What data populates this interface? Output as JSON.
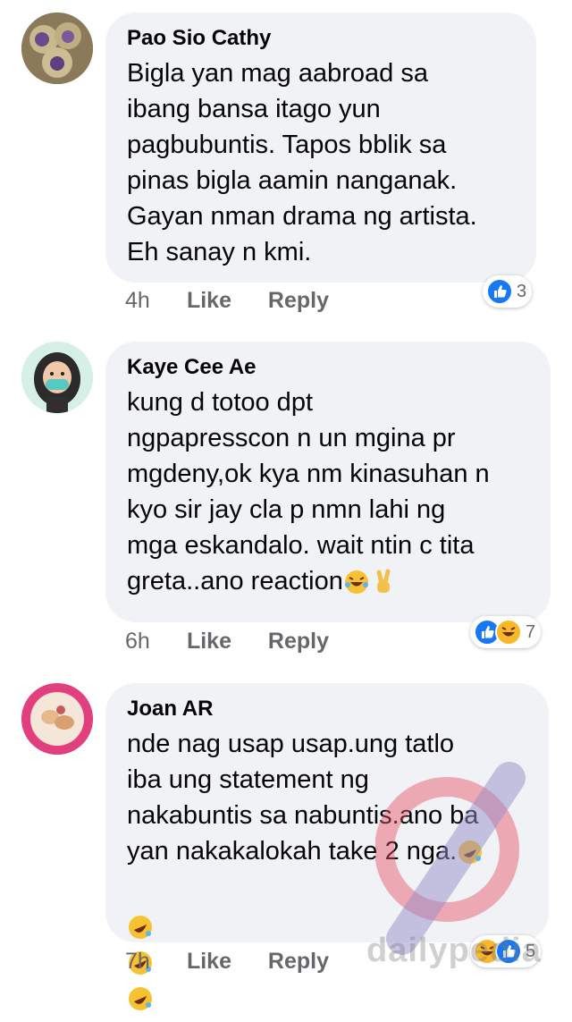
{
  "comments": [
    {
      "author": "Pao Sio Cathy",
      "text": "Bigla yan mag aabroad sa\nibang bansa itago yun\npagbubuntis. Tapos bblik sa\npinas bigla aamin nanganak.\nGayan nman drama ng artista.\nEh sanay n kmi.",
      "time": "4h",
      "like_label": "Like",
      "reply_label": "Reply",
      "reaction_count": "3",
      "reactions": [
        "like-icon"
      ]
    },
    {
      "author": "Kaye Cee Ae",
      "text": "kung d totoo dpt\nngpapresscon n un mgina pr\nmgdeny,ok kya nm kinasuhan n\nkyo sir jay  cla p nmn lahi ng\nmga eskandalo. wait ntin c tita\ngreta..ano reaction",
      "time": "6h",
      "like_label": "Like",
      "reply_label": "Reply",
      "reaction_count": "7",
      "reactions": [
        "like-icon",
        "haha-icon"
      ]
    },
    {
      "author": "Joan AR",
      "text": "nde nag usap usap.ung tatlo\niba ung statement ng\nnakabuntis sa nabuntis.ano ba\nyan nakakalokah take 2 nga.",
      "time": "7h",
      "like_label": "Like",
      "reply_label": "Reply",
      "reaction_count": "5",
      "reactions": [
        "haha-icon",
        "like-icon"
      ]
    }
  ],
  "watermark": "dailypedia",
  "colors": {
    "bubble": "#f0f2f5",
    "meta_text": "#65676b",
    "like_blue": "#1877f2",
    "haha_yellow": "#f7b928"
  }
}
